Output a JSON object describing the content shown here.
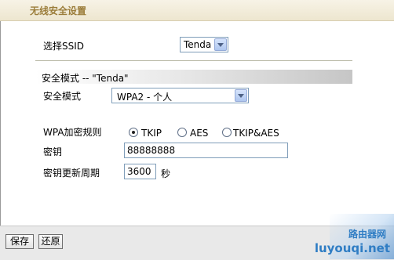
{
  "title": "无线安全设置",
  "ssid": {
    "label": "选择SSID",
    "value": "Tenda"
  },
  "section": {
    "header": "安全模式 -- \"Tenda\""
  },
  "security_mode": {
    "label": "安全模式",
    "value": "WPA2 - 个人"
  },
  "encryption": {
    "label": "WPA加密规则",
    "options": [
      {
        "label": "TKIP",
        "selected": true
      },
      {
        "label": "AES",
        "selected": false
      },
      {
        "label": "TKIP&AES",
        "selected": false
      }
    ]
  },
  "key": {
    "label": "密钥",
    "value": "88888888"
  },
  "renewal": {
    "label": "密钥更新周期",
    "value": "3600",
    "unit": "秒"
  },
  "buttons": {
    "save": "保存",
    "restore": "还原"
  },
  "watermark": {
    "cn": "路由器网",
    "en": "luyouqi.net"
  }
}
